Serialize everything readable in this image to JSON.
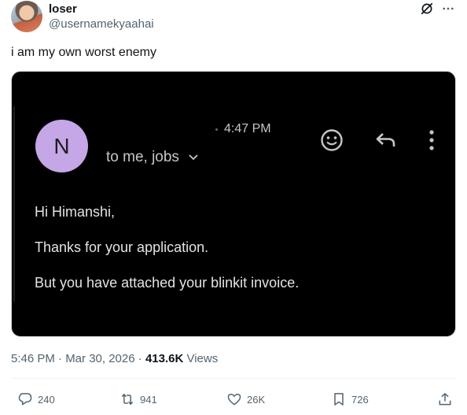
{
  "author": {
    "display_name": "loser",
    "handle": "@usernamekyaahai"
  },
  "tweet": {
    "text": "i am my own worst enemy",
    "timestamp": "5:46 PM · Mar 30, 2026",
    "separator": " · ",
    "views_count": "413.6K",
    "views_label": "Views"
  },
  "email": {
    "sender_initial": "N",
    "recipients": "to me, jobs",
    "time": "4:47 PM",
    "greeting": "Hi Himanshi,",
    "line1": "Thanks for your application.",
    "line2": "But you have attached your blinkit invoice."
  },
  "actions": {
    "replies": "240",
    "reposts": "941",
    "likes": "26K",
    "bookmarks": "726"
  },
  "colors": {
    "email_bg": "#000000",
    "avatar_purple": "#c5a6e6",
    "text_secondary": "#536471"
  }
}
